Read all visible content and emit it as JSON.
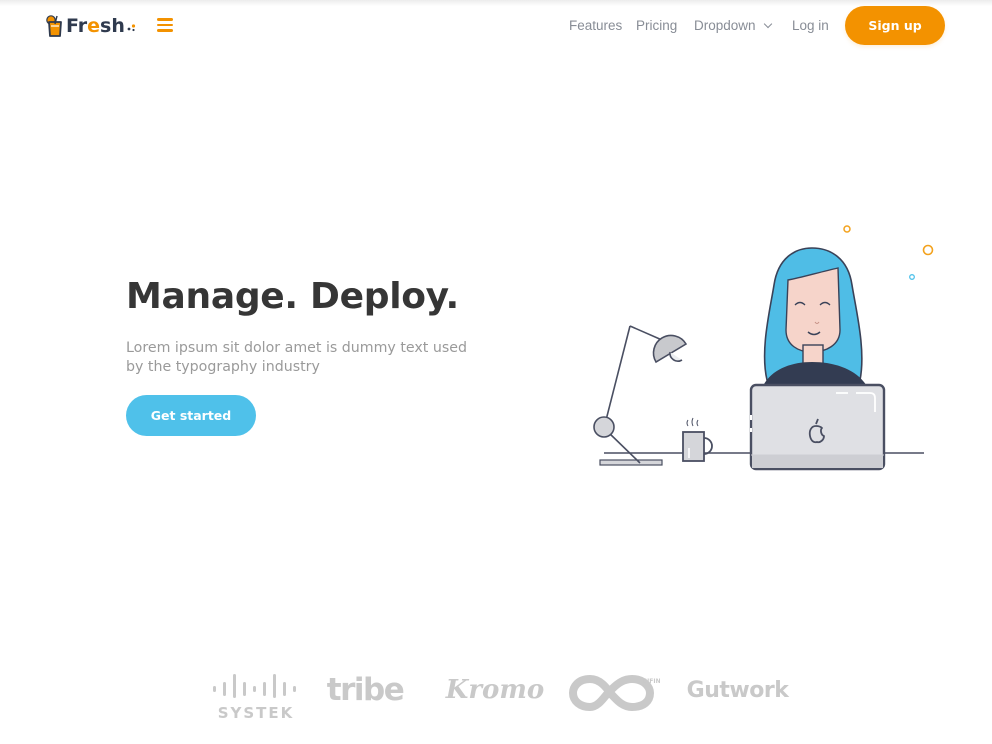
{
  "brand": {
    "name_prefix": "Fr",
    "name_accent": "e",
    "name_suffix": "sh",
    "accent_color": "#f39200",
    "primary_color": "#4fc1ea",
    "dark_color": "#2f3a4e"
  },
  "navbar": {
    "menu_icon": "hamburger-icon",
    "links": [
      {
        "label": "Features"
      },
      {
        "label": "Pricing"
      },
      {
        "label": "Dropdown",
        "icon": "chevron-down-icon"
      },
      {
        "label": "Log in"
      }
    ],
    "signup_label": "Sign up"
  },
  "hero": {
    "title": "Manage. Deploy.",
    "subtitle": "Lorem ipsum sit dolor amet is dummy text used by the typography industry",
    "cta_label": "Get started",
    "illustration": "woman-at-laptop-with-desk-lamp-and-coffee-mug"
  },
  "clients": {
    "logos": [
      {
        "name": "SYSTEK"
      },
      {
        "name": "tribe"
      },
      {
        "name": "Kromo"
      },
      {
        "name": "INFINITE"
      },
      {
        "name": "Gutwork"
      }
    ]
  }
}
